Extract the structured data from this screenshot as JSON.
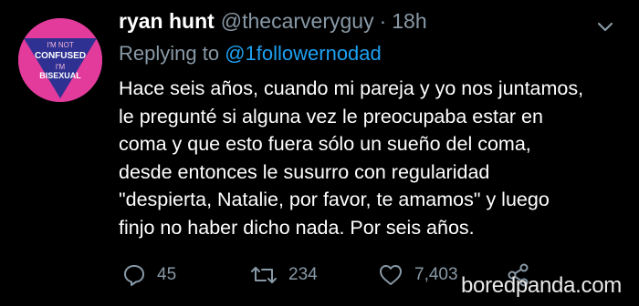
{
  "tweet": {
    "display_name": "ryan hunt",
    "handle": "@thecarveryguy",
    "separator": "·",
    "time": "18h",
    "replying_prefix": "Replying to",
    "replying_to": "@1followernodad",
    "body_lines": [
      "Hace seis años, cuando mi pareja y yo nos juntamos,",
      "le pregunté si alguna vez le preocupaba estar en",
      "coma y que esto fuera sólo un sueño del coma,",
      "desde entonces le susurro con regularidad",
      "\"despierta, Natalie, por favor, te amamos\" y luego",
      "finjo no haber dicho nada. Por seis años."
    ],
    "actions": {
      "replies": "45",
      "retweets": "234",
      "likes": "7,403"
    }
  },
  "avatar": {
    "line1": "I'M NOT",
    "line2": "CONFUSED",
    "line3": "I'M",
    "line4": "BISEXUAL",
    "background_color": "#e23b9c",
    "triangle_color": "#2e3192"
  },
  "colors": {
    "background": "#000000",
    "text": "#ffffff",
    "muted": "#8899a6",
    "link": "#1da1f2"
  },
  "icons": {
    "reply": "reply-icon",
    "retweet": "retweet-icon",
    "like": "heart-icon",
    "share": "share-icon",
    "caret": "chevron-down-icon"
  },
  "watermark": {
    "text": "boredpanda.com"
  }
}
